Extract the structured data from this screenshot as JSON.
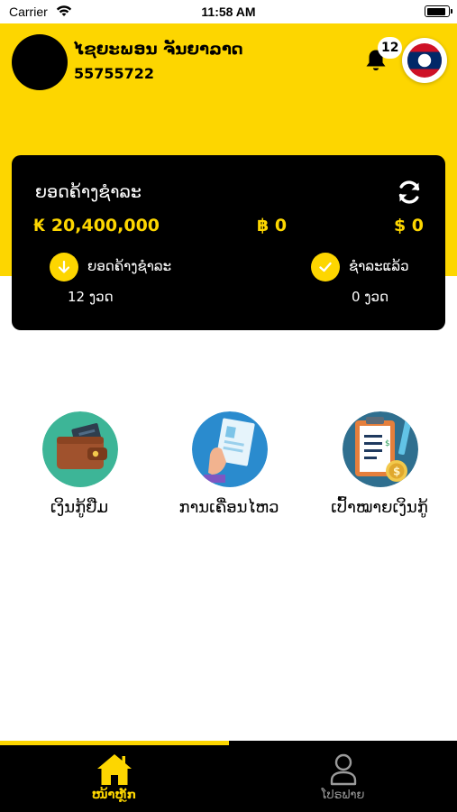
{
  "status_bar": {
    "carrier": "Carrier",
    "time": "11:58 AM",
    "battery_level": 0.9
  },
  "header": {
    "user_name": "ໄຊຍະພອນ ຈັນຍາລາດ",
    "user_phone": "55755722",
    "notification_count": "12",
    "flag_icon": "laos-flag-icon",
    "bell_icon": "bell-icon"
  },
  "balance_card": {
    "title": "ຍອດຄ້າງຊຳລະ",
    "refresh_icon": "refresh-icon",
    "amount_kip": "₭ 20,400,000",
    "amount_baht": "฿ 0",
    "amount_usd": "$ 0",
    "pending": {
      "icon": "arrow-down-icon",
      "label": "ຍອດຄ້າງຊຳລະ",
      "count": "12 ງວດ"
    },
    "paid": {
      "icon": "check-icon",
      "label": "ຊຳລະແລ້ວ",
      "count": "0 ງວດ"
    }
  },
  "menu": {
    "items": [
      {
        "label": "ເງິນກູ້ຢືມ",
        "icon": "wallet-icon"
      },
      {
        "label": "ການເຄື່ອນໄຫວ",
        "icon": "document-hand-icon"
      },
      {
        "label": "ເປົ້າໝາຍເງິນກູ້",
        "icon": "clipboard-coin-icon"
      }
    ]
  },
  "tabbar": {
    "home_label": "ໜ້າຫຼັກ",
    "profile_label": "ໂປຣຟາຍ",
    "home_icon": "home-icon",
    "profile_icon": "user-icon"
  },
  "colors": {
    "brand_yellow": "#FDD600",
    "card_black": "#000000",
    "inactive_gray": "#9A9A9A"
  }
}
